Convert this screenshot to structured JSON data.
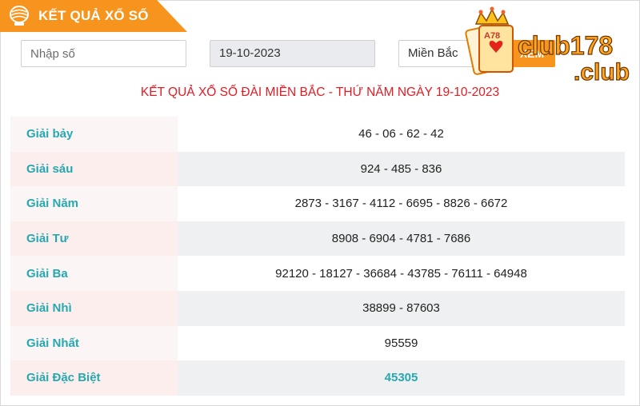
{
  "header": {
    "title": "KẾT QUẢ XỔ SỐ"
  },
  "form": {
    "number_placeholder": "Nhập số",
    "date_value": "19-10-2023",
    "region_value": "Miền Bắc",
    "view_label": "XEM"
  },
  "result_heading": "KẾT QUẢ XỔ SỐ ĐÀI MIỀN BẮC - THỨ NĂM NGÀY 19-10-2023",
  "prizes": [
    {
      "name": "Giải bảy",
      "numbers": "46 - 06 - 62 - 42"
    },
    {
      "name": "Giải sáu",
      "numbers": "924 - 485 - 836"
    },
    {
      "name": "Giải Năm",
      "numbers": "2873 - 3167 - 4112 - 6695 - 8826 - 6672"
    },
    {
      "name": "Giải Tư",
      "numbers": "8908 - 6904 - 4781 - 7686"
    },
    {
      "name": "Giải Ba",
      "numbers": "92120 - 18127 - 36684 - 43785 - 76111 - 64948"
    },
    {
      "name": "Giải Nhì",
      "numbers": "38899 - 87603"
    },
    {
      "name": "Giải Nhất",
      "numbers": "95559"
    },
    {
      "name": "Giải Đặc Biệt",
      "numbers": "45305"
    }
  ],
  "brand": {
    "line1": "club178",
    "line2": ".club",
    "card_text": "A78"
  },
  "colors": {
    "accent": "#f7941d",
    "heading_red": "#e31b23",
    "prize_teal": "#26a8b0",
    "logo_orange": "#ffa51f"
  }
}
